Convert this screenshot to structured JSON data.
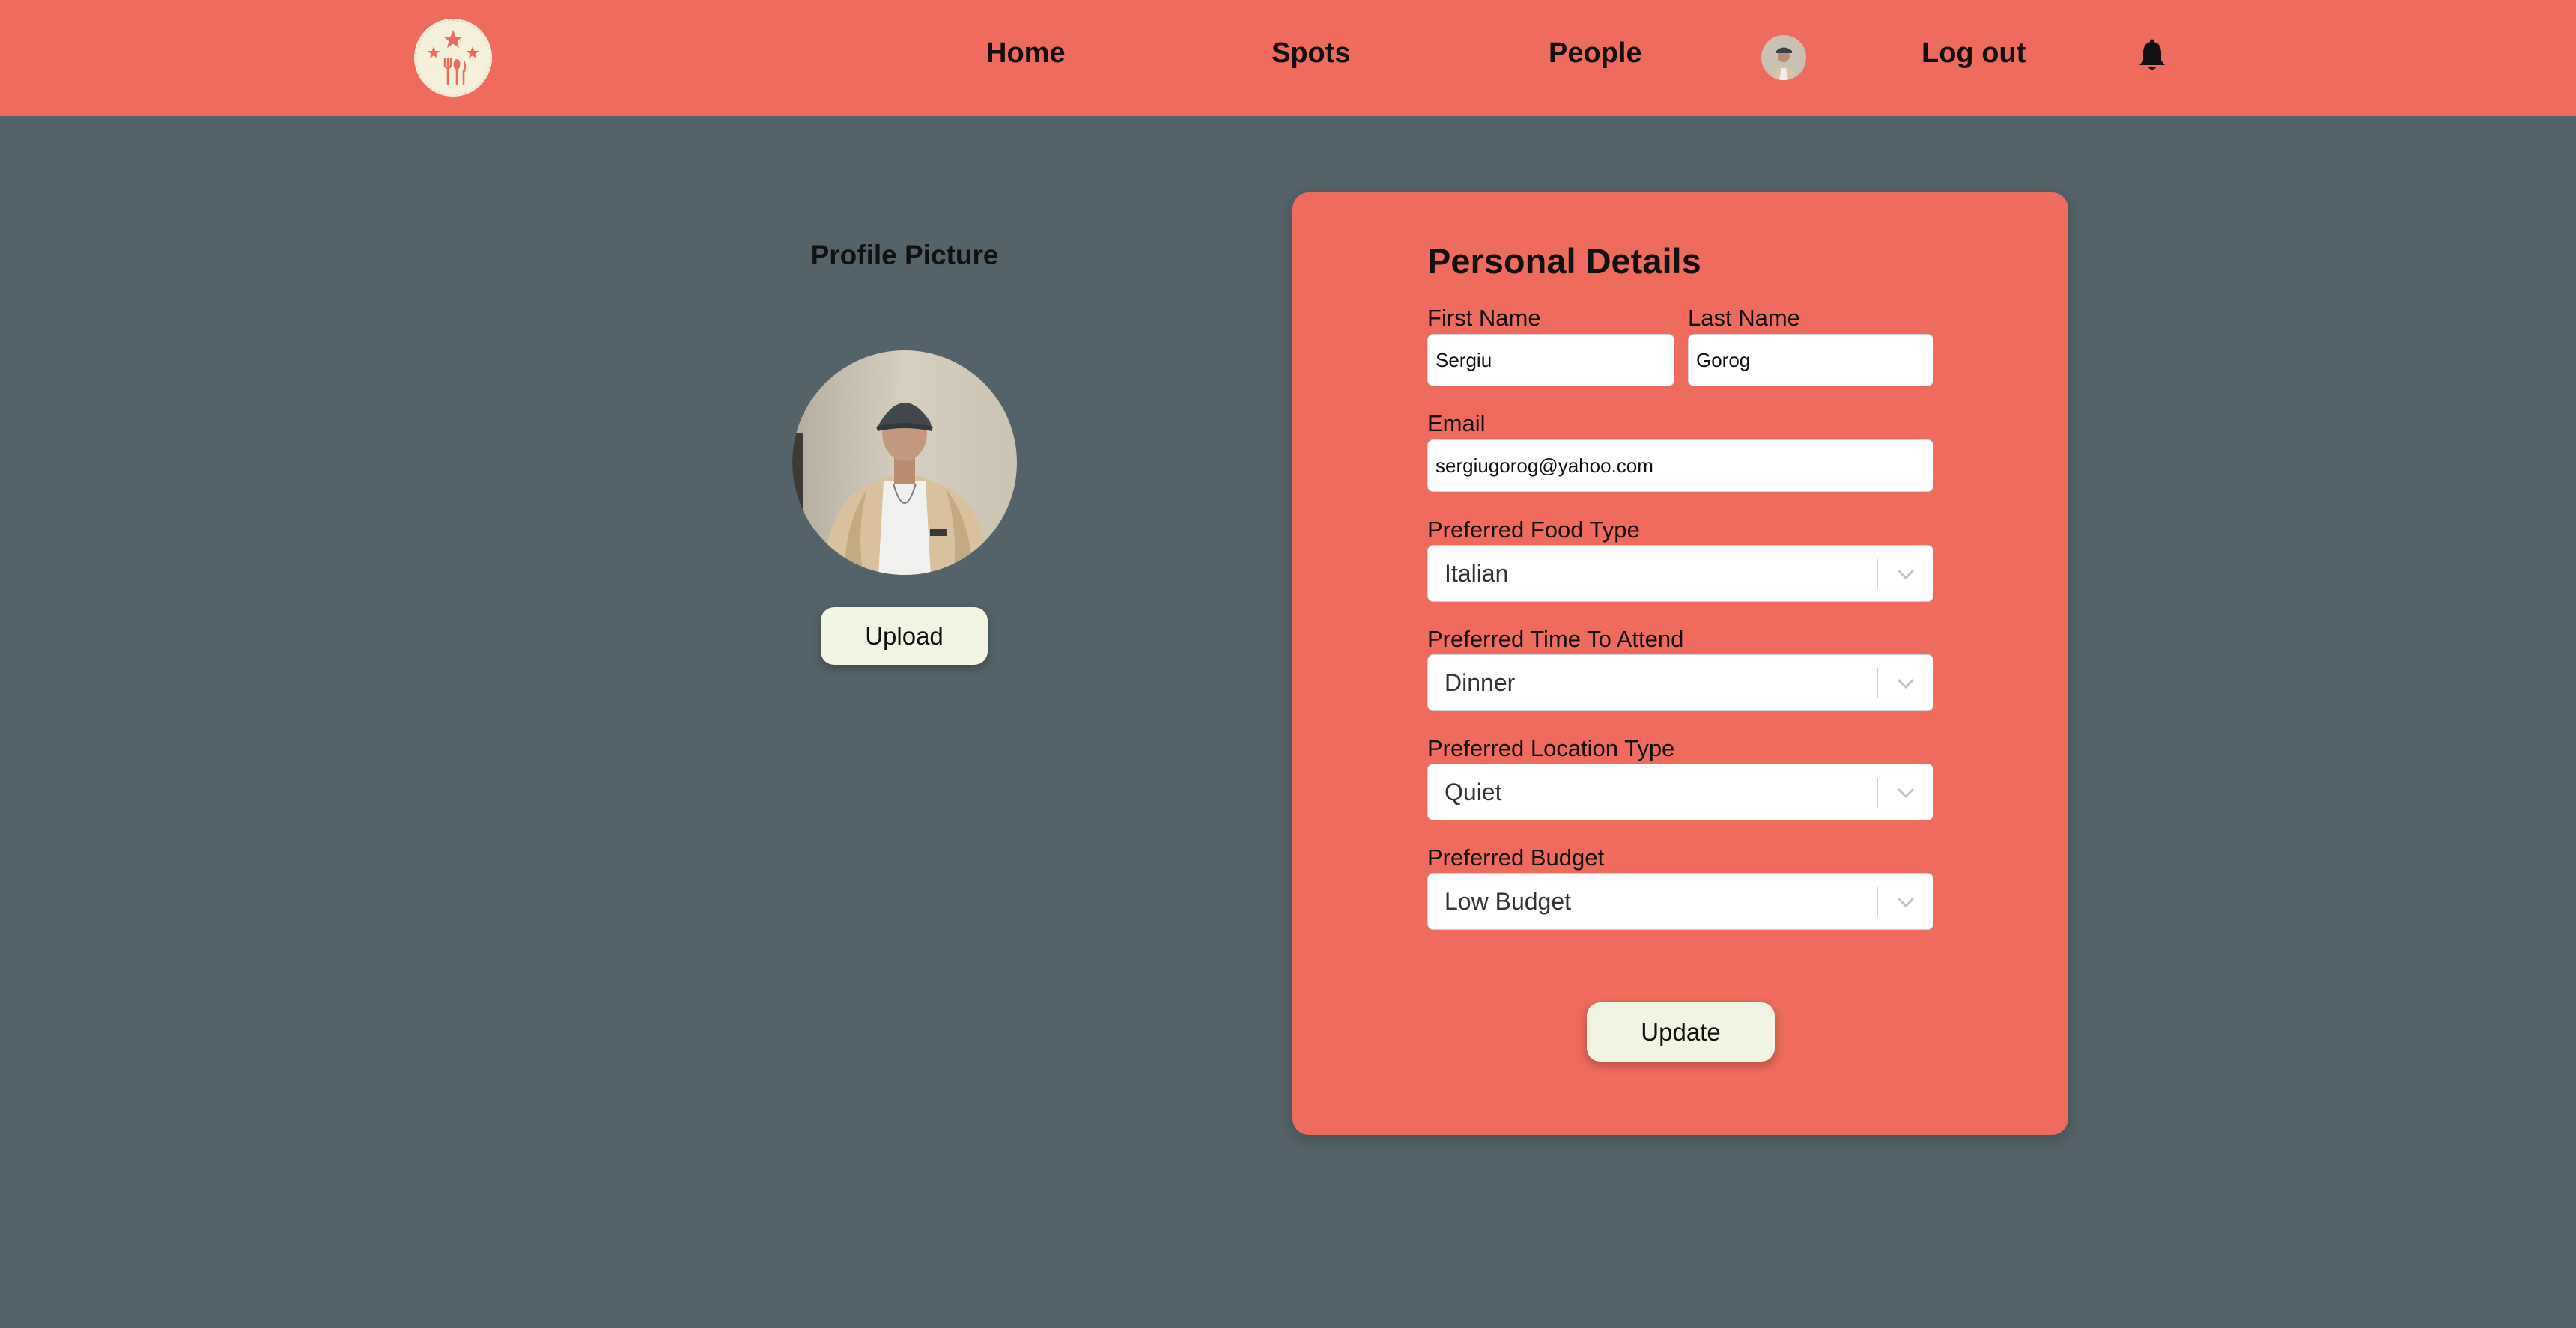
{
  "nav": {
    "links": [
      "Home",
      "Spots",
      "People",
      "Log out"
    ]
  },
  "profile": {
    "title": "Profile Picture",
    "upload_label": "Upload"
  },
  "form": {
    "title": "Personal Details",
    "first_name": {
      "label": "First Name",
      "value": "Sergiu"
    },
    "last_name": {
      "label": "Last Name",
      "value": "Gorog"
    },
    "email": {
      "label": "Email",
      "value": "sergiugorog@yahoo.com"
    },
    "food_type": {
      "label": "Preferred Food Type",
      "value": "Italian"
    },
    "time": {
      "label": "Preferred Time To Attend",
      "value": "Dinner"
    },
    "location": {
      "label": "Preferred Location Type",
      "value": "Quiet"
    },
    "budget": {
      "label": "Preferred Budget",
      "value": "Low Budget"
    },
    "update_label": "Update"
  },
  "icons": {
    "logo": "restaurant-stars-logo-icon",
    "avatar": "user-avatar",
    "notifications": "bell-icon",
    "dropdown": "chevron-down-icon"
  },
  "colors": {
    "background": "#546369",
    "accent": "#ee6b5e",
    "button": "#f1f4e0",
    "logo_bg": "#f4f0da"
  }
}
